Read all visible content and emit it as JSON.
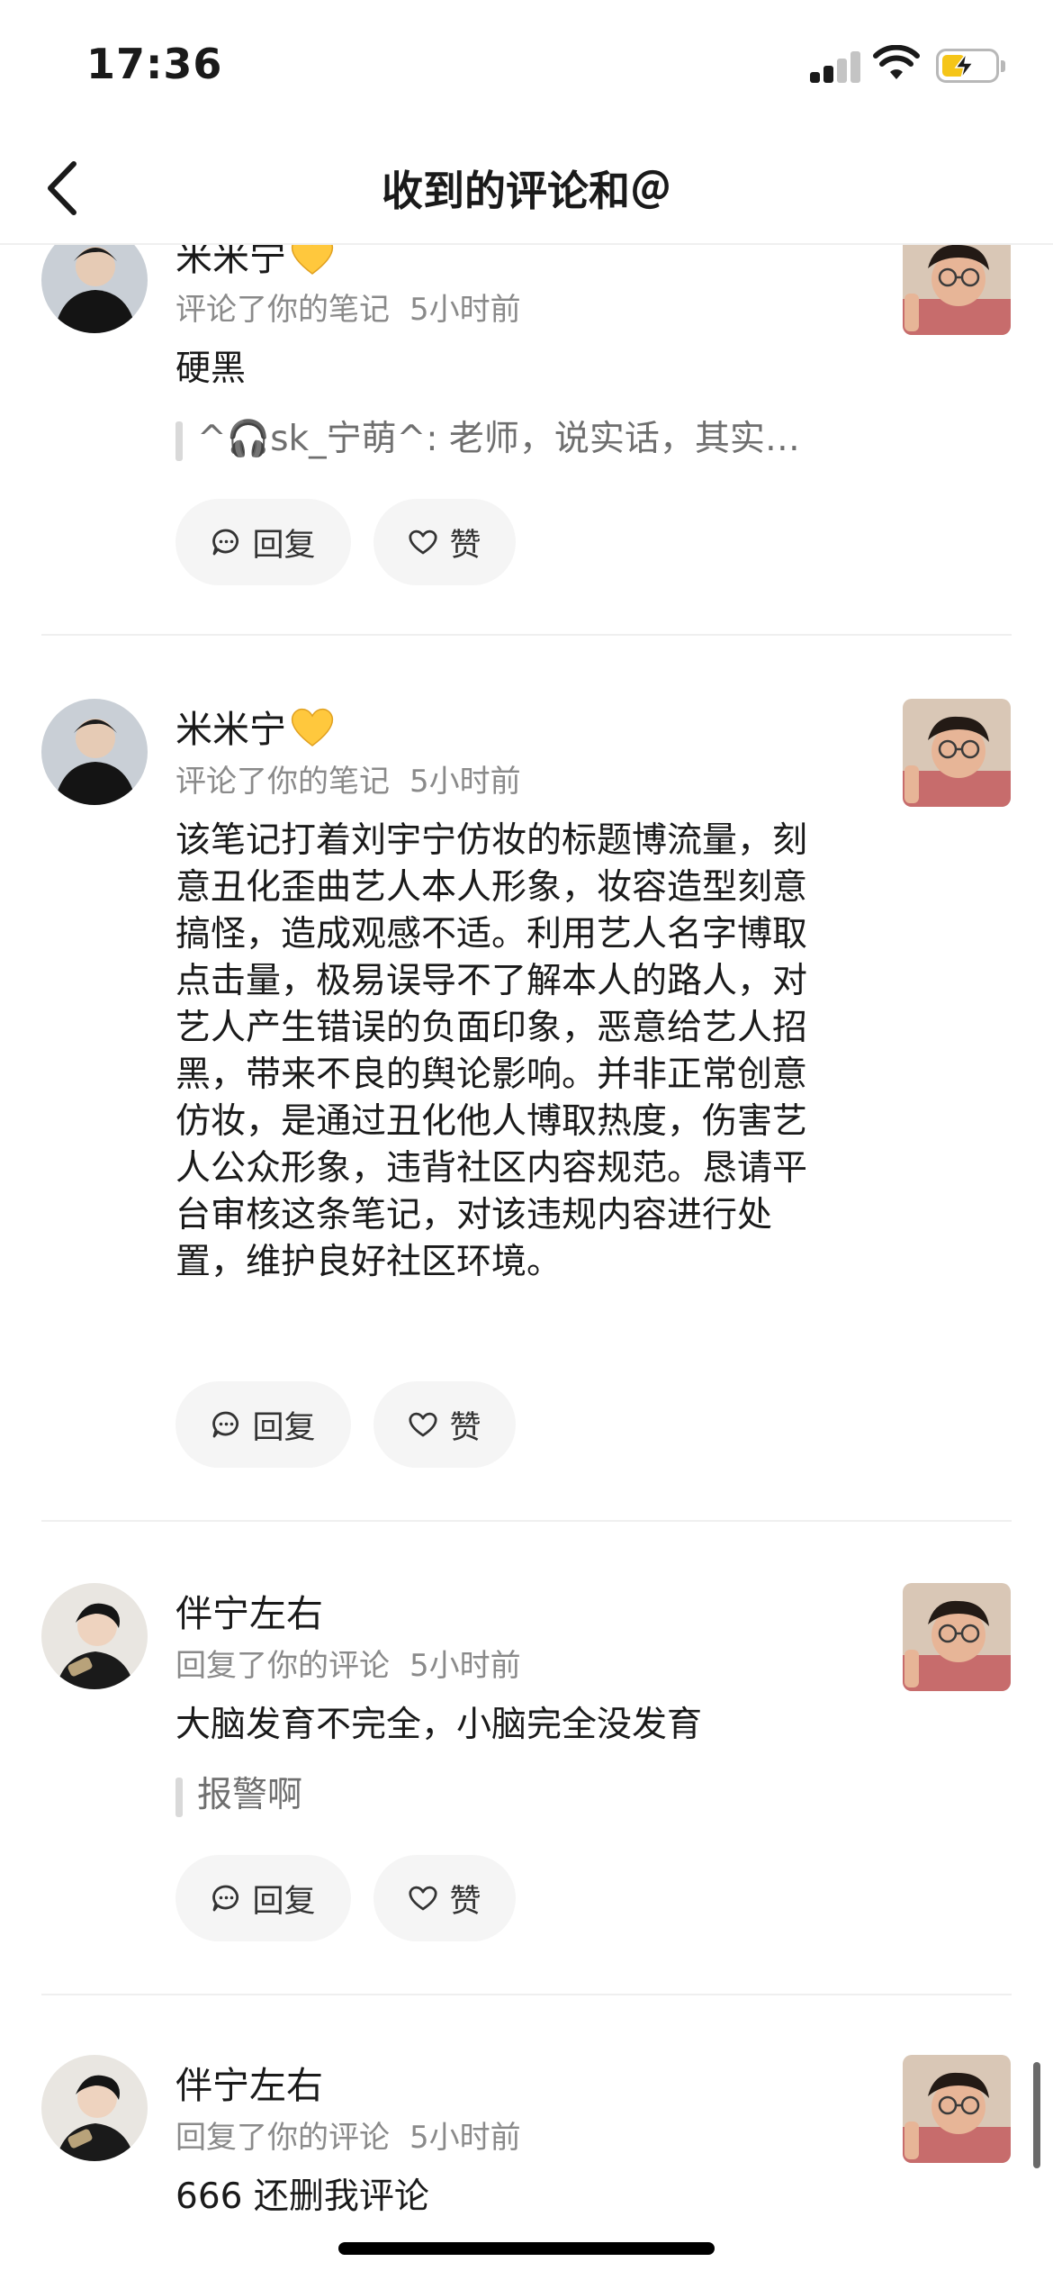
{
  "status_bar": {
    "time": "17:36",
    "battery_level": 0.45
  },
  "nav": {
    "title": "收到的评论和＠"
  },
  "actions": {
    "reply_label": "回复",
    "like_label": "赞"
  },
  "notifications": [
    {
      "username": "米米宁",
      "badge_emoji": "yellow-heart",
      "action": "评论了你的笔记",
      "time_ago": "5小时前",
      "content": "硬黑",
      "quote": "^🎧sk_宁萌^: 老师，说实话，其实…"
    },
    {
      "username": "米米宁",
      "badge_emoji": "yellow-heart",
      "action": "评论了你的笔记",
      "time_ago": "5小时前",
      "content": "该笔记打着刘宇宁仿妆的标题博流量，刻意丑化歪曲艺人本人形象，妆容造型刻意搞怪，造成观感不适。利用艺人名字博取点击量，极易误导不了解本人的路人，对艺人产生错误的负面印象，恶意给艺人招黑，带来不良的舆论影响。并非正常创意仿妆，是通过丑化他人博取热度，伤害艺人公众形象，违背社区内容规范。恳请平台审核这条笔记，对该违规内容进行处置，维护良好社区环境。"
    },
    {
      "username": "伴宁左右",
      "action": "回复了你的评论",
      "time_ago": "5小时前",
      "content": "大脑发育不完全，小脑完全没发育",
      "quote": "报警啊"
    },
    {
      "username": "伴宁左右",
      "action": "回复了你的评论",
      "time_ago": "5小时前",
      "content": "666 还删我评论"
    }
  ]
}
